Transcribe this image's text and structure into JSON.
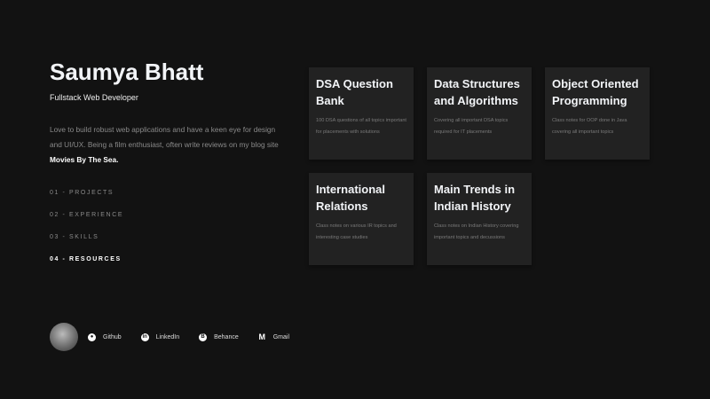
{
  "profile": {
    "name": "Saumya Bhatt",
    "role": "Fullstack Web Developer",
    "bio": "Love to build robust web applications and have a keen eye for design and UI/UX. Being a film enthusiast, often write reviews on my blog site",
    "blog": "Movies By The Sea."
  },
  "nav": [
    {
      "label": "01 - PROJECTS"
    },
    {
      "label": "02 - EXPERIENCE"
    },
    {
      "label": "03 - SKILLS"
    },
    {
      "label": "04 - RESOURCES"
    }
  ],
  "links": [
    {
      "label": "Github",
      "icon": "github-icon"
    },
    {
      "label": "LinkedIn",
      "icon": "linkedin-icon"
    },
    {
      "label": "Behance",
      "icon": "behance-icon"
    },
    {
      "label": "Gmail",
      "icon": "gmail-icon"
    }
  ],
  "cards": [
    {
      "title": "DSA Question Bank",
      "desc": "100 DSA questions of all topics important for placements with solutions"
    },
    {
      "title": "Data Structures and Algorithms",
      "desc": "Covering all important DSA topics required for IT placements"
    },
    {
      "title": "Object Oriented Programming",
      "desc": "Class notes for OOP done in Java covering all important topics"
    },
    {
      "title": "International Relations",
      "desc": "Class notes on various IR topics and interesting case studies"
    },
    {
      "title": "Main Trends in Indian History",
      "desc": "Class notes on Indian History covering important topics and decussions"
    }
  ]
}
